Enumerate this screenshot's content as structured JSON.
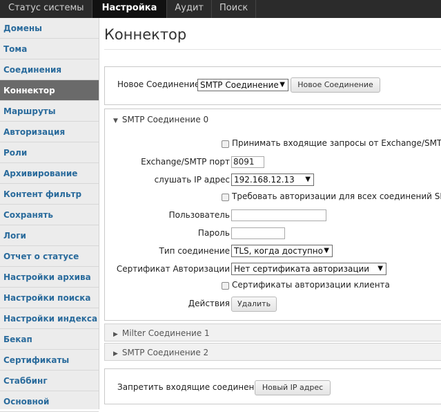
{
  "topnav": {
    "tabs": [
      {
        "label": "Статус системы"
      },
      {
        "label": "Настройка"
      },
      {
        "label": "Аудит"
      },
      {
        "label": "Поиск"
      }
    ]
  },
  "sidebar": {
    "items": [
      {
        "label": "Домены"
      },
      {
        "label": "Тома"
      },
      {
        "label": "Соединения"
      },
      {
        "label": "Коннектор"
      },
      {
        "label": "Маршруты"
      },
      {
        "label": "Авторизация"
      },
      {
        "label": "Роли"
      },
      {
        "label": "Архивирование"
      },
      {
        "label": "Контент фильтр"
      },
      {
        "label": "Сохранять"
      },
      {
        "label": "Логи"
      },
      {
        "label": "Отчет о статусе"
      },
      {
        "label": "Настройки архива"
      },
      {
        "label": "Настройки поиска"
      },
      {
        "label": "Настройки индекса"
      },
      {
        "label": "Бекап"
      },
      {
        "label": "Сертификаты"
      },
      {
        "label": "Стаббинг"
      },
      {
        "label": "Основной"
      }
    ]
  },
  "main": {
    "title": "Коннектор",
    "new_connection": {
      "label": "Новое Соединение",
      "select_value": "SMTP Соединение",
      "button": "Новое Соединение"
    },
    "connection": {
      "header": "SMTP Соединение 0",
      "accept_exchange_label": "Принимать входящие запросы от Exchange/SMTP",
      "port_label": "Exchange/SMTP порт",
      "port_value": "8091",
      "listen_ip_label": "слушать IP адрес",
      "listen_ip_value": "192.168.12.13",
      "require_auth_label": "Требовать авторизации для всех соединений SMTP",
      "user_label": "Пользователь",
      "user_value": "",
      "password_label": "Пароль",
      "password_value": "",
      "conn_type_label": "Тип соединение",
      "conn_type_value": "TLS, когда доступно",
      "auth_cert_label": "Сертификат Авторизации",
      "auth_cert_value": "Нет сертификата авторизации",
      "client_cert_label": "Сертификаты авторизации клиента",
      "actions_label": "Действия",
      "delete_button": "Удалить"
    },
    "collapsed": [
      {
        "label": "Milter Соединение 1"
      },
      {
        "label": "SMTP Соединение 2"
      }
    ],
    "block": {
      "label": "Запретить входящие соединения",
      "button": "Новый IP адрес"
    }
  }
}
